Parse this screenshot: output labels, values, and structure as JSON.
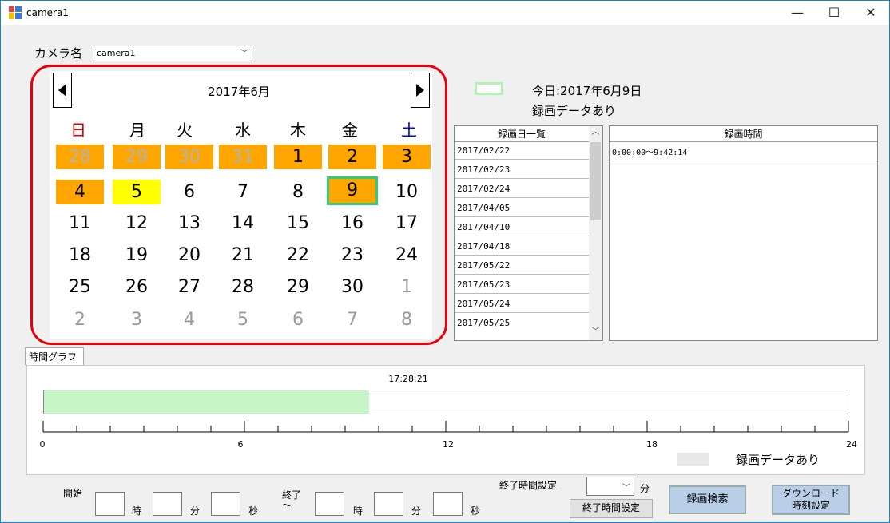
{
  "window": {
    "title": "camera1",
    "minimize": "—",
    "maximize": "☐",
    "close": "✕"
  },
  "camera": {
    "label": "カメラ名",
    "value": "camera1"
  },
  "calendar": {
    "title": "2017年6月",
    "weekdays": [
      "日",
      "月",
      "火",
      "水",
      "木",
      "金",
      "土"
    ],
    "weeks": [
      [
        "28",
        "29",
        "30",
        "31",
        "1",
        "2",
        "3"
      ],
      [
        "4",
        "5",
        "6",
        "7",
        "8",
        "9",
        "10"
      ],
      [
        "11",
        "12",
        "13",
        "14",
        "15",
        "16",
        "17"
      ],
      [
        "18",
        "19",
        "20",
        "21",
        "22",
        "23",
        "24"
      ],
      [
        "25",
        "26",
        "27",
        "28",
        "29",
        "30",
        "1"
      ],
      [
        "2",
        "3",
        "4",
        "5",
        "6",
        "7",
        "8"
      ]
    ]
  },
  "legend": {
    "today": "今日:2017年6月9日",
    "has_data": "録画データあり"
  },
  "date_list": {
    "header": "録画日一覧",
    "items": [
      "2017/02/22",
      "2017/02/23",
      "2017/02/24",
      "2017/04/05",
      "2017/04/10",
      "2017/04/18",
      "2017/05/22",
      "2017/05/23",
      "2017/05/24",
      "2017/05/25"
    ]
  },
  "time_list": {
    "header": "録画時間",
    "items": [
      "0:00:00〜9:42:14"
    ]
  },
  "graph": {
    "tab": "時間グラフ",
    "cursor_time": "17:28:21",
    "recorded_fraction": 0.4043,
    "axis_labels": [
      "0",
      "6",
      "12",
      "18",
      "24"
    ],
    "legend": "録画データあり"
  },
  "search": {
    "start_label": "開始",
    "end_label": "終了",
    "tilde": "〜",
    "hour": "時",
    "minute": "分",
    "second": "秒",
    "endtime_setting_label": "終了時間設定",
    "endtime_unit": "分",
    "endtime_button": "終了時間設定",
    "search_button": "録画検索",
    "download_button_line1": "ダウンロード",
    "download_button_line2": "時刻設定"
  },
  "colors": {
    "recorded": "#ffa500",
    "selected": "#ffff00",
    "today_border": "#33cc77",
    "graph_fill": "#c8f5c8",
    "highlight": "#e8000b"
  }
}
